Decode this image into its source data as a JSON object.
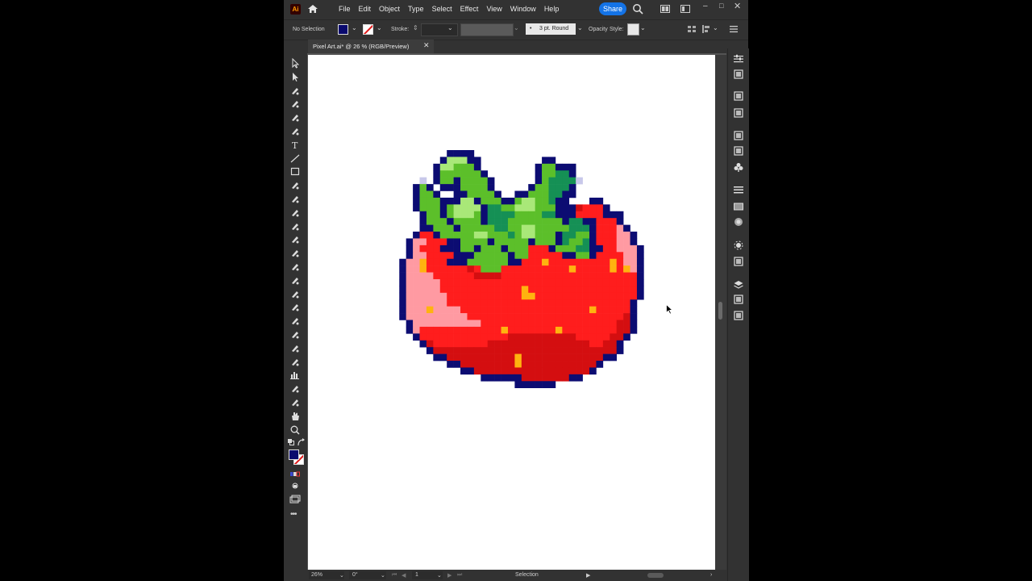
{
  "app": {
    "logo": "Ai"
  },
  "menu": [
    "File",
    "Edit",
    "Object",
    "Type",
    "Select",
    "Effect",
    "View",
    "Window",
    "Help"
  ],
  "share_label": "Share",
  "window_controls": {
    "minimize": "–",
    "maximize": "□",
    "close": "✕"
  },
  "control_bar": {
    "selection_status": "No Selection",
    "fill_color": "#0a0a6e",
    "stroke_label": "Stroke:",
    "brush": "3 pt. Round",
    "opacity_label": "Opacity",
    "styles_label": "Style:"
  },
  "document_tab": {
    "title": "Pixel Art.ai* @ 26 % (RGB/Preview)",
    "close": "✕"
  },
  "status_bar": {
    "zoom": "26%",
    "rotation": "0°",
    "artboard": "1",
    "tool": "Selection"
  },
  "toolbar": {
    "tools": [
      "selection-tool",
      "direct-selection-tool",
      "magic-wand-tool",
      "lasso-tool",
      "pen-tool",
      "curvature-tool",
      "type-tool",
      "line-segment-tool",
      "rectangle-tool",
      "paintbrush-tool",
      "shaper-tool",
      "eraser-tool",
      "rotate-tool",
      "scale-tool",
      "warp-tool",
      "free-transform-tool",
      "shape-builder-tool",
      "perspective-grid-tool",
      "mesh-tool",
      "gradient-tool",
      "eyedropper-tool",
      "blend-tool",
      "symbol-sprayer-tool",
      "column-graph-tool",
      "artboard-tool",
      "slice-tool",
      "hand-tool",
      "zoom-tool"
    ],
    "more": "•••"
  },
  "right_panels": [
    "properties-icon",
    "libraries-icon",
    "color-guide-icon",
    "color-icon",
    "swatches-icon",
    "brushes-icon",
    "symbols-icon",
    "stroke-icon",
    "gradient-icon",
    "transparency-icon",
    "appearance-icon",
    "graphic-styles-icon",
    "layers-icon",
    "export-icon",
    "transform-icon"
  ],
  "colors": {
    "accent": "#1473e6",
    "strawberry_red": "#ff1f1f",
    "leaf_green": "#5cc02c",
    "outline": "#0a0a6e"
  },
  "artwork": {
    "palette": {
      "O": "#0c0c72",
      "R": "#ff1d1d",
      "D": "#d40e10",
      "P": "#ff9aa2",
      "G": "#5cbf2a",
      "L": "#a9e878",
      "T": "#159055",
      "S": "#ffb30f",
      "W": "#c8c8ea"
    },
    "rows": [
      "..........OOOO.........................",
      ".........OLLLOO.........OO.............",
      "........OLLGGGO........OGGOOO..........",
      "........OGGGGGGO.......OGGTTO..........",
      "......W.OGGOGGGGO......OGTTTTW.........",
      ".....OGO.OOOGGGGO.....OGGTTTO..........",
      ".....OGGO..OOGGGGO..OOGGGTTOO..........",
      ".....OGGGOOOLLOGGGOOGLLGGTOO...OO.......",
      ".....OGGGOGLLLLOTTGGLLLGGGOOODRRRO......",
      "......OGGOGLLLGOTTTTGGGGTTOOORRRROOO....",
      "......OGGGOGGGGOTTTGGGGGGGGOTTOORRRO....",
      "......OOGGGOGGGGGTTGGLLGGGGGTTTORRRPO...",
      ".....ORROGGGGGLLGGGTGLLGGGOTTGGORRRPPO..",
      "....OPPRRROOGGGGOGGGGGOGGGOTGGTORRRPPO..",
      "....OPRRROOOGGOGGGOGGGRRROGGGTTOORRPPPO.",
      "....OPPRRRROOOGGGGGOGGRRRRROOGGORRRRPPO.",
      "...OPPSRRROOOGGGGGGOORRRSRRRRRRRRRSRPPO.",
      "...OPPSRRRRRRDRGGGRRRRRRRRRRSRRRRRSRSPO.",
      "...OPPPPRRRRRRDDDDRRRRRRRRRRRRRRRRRRRRO.",
      "...OPPPPPRRRRRRRRRRRRRRRRRRRRRRRRRRRRRO.",
      "...OPPPPPRRRRRRRRRRRRSRRRRRRRRRRRRRRRRO.",
      "...OPPPPPPRRRRRRRRRRRSSRRRRRRRRRRRRRRRO.",
      "...OPPPPPPRRRRRRRRRRRRRRRRRRRRRRRRRRRO..",
      "...OPPPSPPPPRRRRRRRRRRRRRRRRRRRSRRRRRO..",
      "...OPPPPPPPPPRRRRRRRRRRRRRRRRRRRRRRRDO..",
      "....OPPPPPPPPPPRRRRRRRRRRRRRRRRRRRRDDO..",
      "....OPRRRRRRRRRRRRSRRRRRRRSRRRRRRRRDDO..",
      ".....ORRRRRRRRRRRRRDDDDDDDDDDRRRRRDDO...",
      "......ODRRRRRRRRDDDDDDDDDDDDDDDRRDDO....",
      ".......ODDDDDDDDDDDDDDDDDDDDDDDDDDDO....",
      "........OODDDDDDDDDDSDDDDDDDDDDDDOO.....",
      "..........OODDDDDDDDSDDDDDDDDDDDO.......",
      "............OODDDDDDDDDDDDDDDDDO........",
      "...............OOOOOODDDDDDDOO..........",
      "....................OOOOOO.............."
    ]
  }
}
